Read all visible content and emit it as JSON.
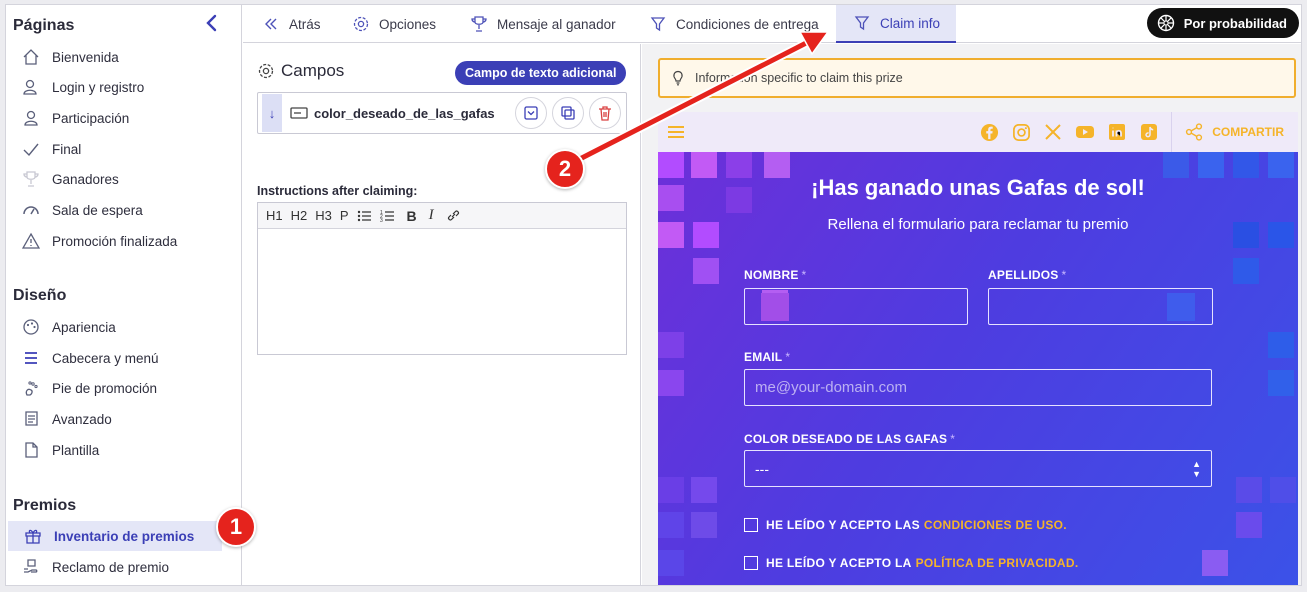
{
  "sidebar": {
    "pages_title": "Páginas",
    "pages": [
      {
        "label": "Bienvenida",
        "icon": "home-icon"
      },
      {
        "label": "Login y registro",
        "icon": "user-add-icon"
      },
      {
        "label": "Participación",
        "icon": "user-icon"
      },
      {
        "label": "Final",
        "icon": "check-icon"
      },
      {
        "label": "Ganadores",
        "icon": "trophy-icon"
      },
      {
        "label": "Sala de espera",
        "icon": "gauge-icon"
      },
      {
        "label": "Promoción finalizada",
        "icon": "warning-icon"
      }
    ],
    "design_title": "Diseño",
    "design": [
      {
        "label": "Apariencia",
        "icon": "palette-icon"
      },
      {
        "label": "Cabecera y menú",
        "icon": "menu-lines-icon"
      },
      {
        "label": "Pie de promoción",
        "icon": "footprint-icon"
      },
      {
        "label": "Avanzado",
        "icon": "scroll-icon"
      },
      {
        "label": "Plantilla",
        "icon": "file-icon"
      }
    ],
    "prizes_title": "Premios",
    "prizes": [
      {
        "label": "Inventario de premios",
        "icon": "gift-icon",
        "active": true
      },
      {
        "label": "Reclamo de premio",
        "icon": "hand-prize-icon"
      }
    ]
  },
  "topbar": {
    "back": "Atrás",
    "options": "Opciones",
    "winner_message": "Mensaje al ganador",
    "delivery": "Condiciones de entrega",
    "claim_info": "Claim info",
    "probability": "Por probabilidad"
  },
  "fields_panel": {
    "title": "Campos",
    "add_button": "Campo de texto adicional",
    "field_name": "color_deseado_de_las_gafas",
    "instructions_label": "Instructions after claiming:",
    "toolbar": [
      "H1",
      "H2",
      "H3",
      "P"
    ]
  },
  "preview": {
    "info_text": "Information specific to claim this prize",
    "share_label": "COMPARTIR",
    "title": "¡Has ganado unas Gafas de sol!",
    "subtitle": "Rellena el formulario para reclamar tu premio",
    "fields": {
      "nombre": "NOMBRE",
      "apellidos": "APELLIDOS",
      "email": "EMAIL",
      "email_placeholder": "me@your-domain.com",
      "color": "COLOR DESEADO DE LAS GAFAS",
      "color_value": "---",
      "required_mark": "*"
    },
    "terms_prefix": "HE LEÍDO Y ACEPTO LAS",
    "terms_link": "CONDICIONES DE USO.",
    "privacy_prefix": "HE LEÍDO Y ACEPTO LA",
    "privacy_link": "POLÍTICA DE PRIVACIDAD."
  },
  "annotations": {
    "one": "1",
    "two": "2"
  },
  "colors": {
    "accent": "#3b3fb6",
    "warning": "#f0ae2e",
    "highlight": "#f5b42a",
    "callout": "#e5231d"
  }
}
